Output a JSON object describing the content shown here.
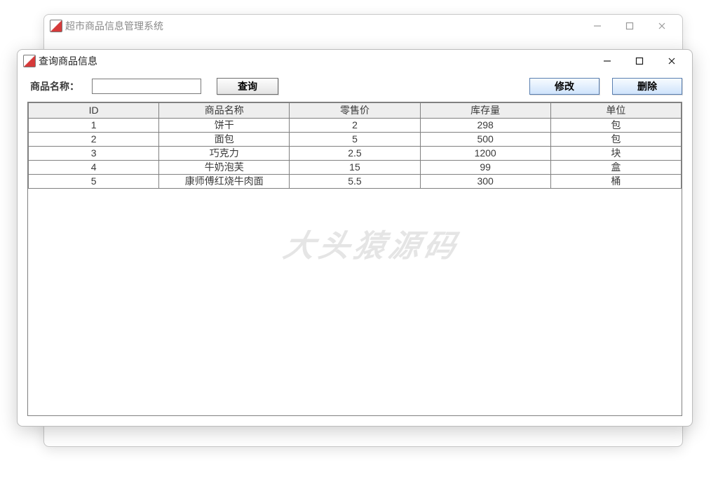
{
  "parent_window": {
    "title": "超市商品信息管理系统"
  },
  "child_window": {
    "title": "查询商品信息"
  },
  "toolbar": {
    "label": "商品名称：",
    "input_value": "",
    "search_label": "查询",
    "modify_label": "修改",
    "delete_label": "删除"
  },
  "table": {
    "headers": [
      "ID",
      "商品名称",
      "零售价",
      "库存量",
      "单位"
    ],
    "rows": [
      {
        "id": "1",
        "name": "饼干",
        "price": "2",
        "stock": "298",
        "unit": "包"
      },
      {
        "id": "2",
        "name": "面包",
        "price": "5",
        "stock": "500",
        "unit": "包"
      },
      {
        "id": "3",
        "name": "巧克力",
        "price": "2.5",
        "stock": "1200",
        "unit": "块"
      },
      {
        "id": "4",
        "name": "牛奶泡芙",
        "price": "15",
        "stock": "99",
        "unit": "盒"
      },
      {
        "id": "5",
        "name": "康师傅红烧牛肉面",
        "price": "5.5",
        "stock": "300",
        "unit": "桶"
      }
    ]
  },
  "watermark": "大头猿源码"
}
